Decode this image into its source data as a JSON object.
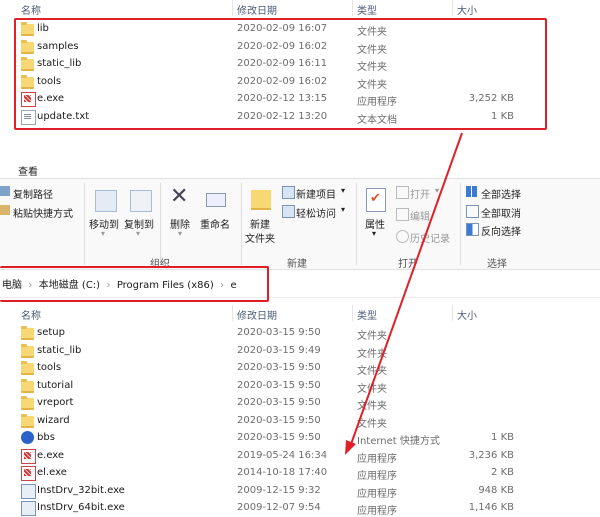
{
  "top_header": {
    "col_name": "名称",
    "col_date": "修改日期",
    "col_type": "类型",
    "col_size": "大小"
  },
  "top_files": [
    {
      "icon": "folder",
      "name": "lib",
      "date": "2020-02-09 16:07",
      "type": "文件夹",
      "size": ""
    },
    {
      "icon": "folder",
      "name": "samples",
      "date": "2020-02-09 16:02",
      "type": "文件夹",
      "size": ""
    },
    {
      "icon": "folder",
      "name": "static_lib",
      "date": "2020-02-09 16:11",
      "type": "文件夹",
      "size": ""
    },
    {
      "icon": "folder",
      "name": "tools",
      "date": "2020-02-09 16:02",
      "type": "文件夹",
      "size": ""
    },
    {
      "icon": "exe",
      "name": "e.exe",
      "date": "2020-02-12 13:15",
      "type": "应用程序",
      "size": "3,252 KB"
    },
    {
      "icon": "text-file",
      "name": "update.txt",
      "date": "2020-02-12 13:20",
      "type": "文本文档",
      "size": "1 KB"
    }
  ],
  "ribbon": {
    "tab_view": "查看",
    "copy_path": "复制路径",
    "paste_shortcut": "粘贴快捷方式",
    "move_to": "移动到",
    "copy_to": "复制到",
    "delete": "删除",
    "rename": "重命名",
    "new_folder_line1": "新建",
    "new_folder_line2": "文件夹",
    "new_item": "新建项目",
    "easy_access": "轻松访问",
    "properties": "属性",
    "open": "打开",
    "edit": "编辑",
    "history": "历史记录",
    "select_all": "全部选择",
    "select_none": "全部取消",
    "invert_selection": "反向选择",
    "group_organize": "组织",
    "group_new": "新建",
    "group_open": "打开",
    "group_select": "选择"
  },
  "breadcrumb": {
    "pc": "电脑",
    "drive": "本地磁盘 (C:)",
    "program_files": "Program Files (x86)",
    "folder": "e"
  },
  "bottom_header": {
    "col_name": "名称",
    "col_date": "修改日期",
    "col_type": "类型",
    "col_size": "大小"
  },
  "bottom_files": [
    {
      "icon": "folder",
      "name": "setup",
      "date": "2020-03-15 9:50",
      "type": "文件夹",
      "size": ""
    },
    {
      "icon": "folder",
      "name": "static_lib",
      "date": "2020-03-15 9:49",
      "type": "文件夹",
      "size": ""
    },
    {
      "icon": "folder",
      "name": "tools",
      "date": "2020-03-15 9:50",
      "type": "文件夹",
      "size": ""
    },
    {
      "icon": "folder",
      "name": "tutorial",
      "date": "2020-03-15 9:50",
      "type": "文件夹",
      "size": ""
    },
    {
      "icon": "folder",
      "name": "vreport",
      "date": "2020-03-15 9:50",
      "type": "文件夹",
      "size": ""
    },
    {
      "icon": "folder",
      "name": "wizard",
      "date": "2020-03-15 9:50",
      "type": "文件夹",
      "size": ""
    },
    {
      "icon": "internet-shortcut",
      "name": "bbs",
      "date": "2020-03-15 9:50",
      "type": "Internet 快捷方式",
      "size": "1 KB"
    },
    {
      "icon": "exe",
      "name": "e.exe",
      "date": "2019-05-24 16:34",
      "type": "应用程序",
      "size": "3,236 KB"
    },
    {
      "icon": "exe",
      "name": "el.exe",
      "date": "2014-10-18 17:40",
      "type": "应用程序",
      "size": "2 KB"
    },
    {
      "icon": "installer",
      "name": "InstDrv_32bit.exe",
      "date": "2009-12-15 9:32",
      "type": "应用程序",
      "size": "948 KB"
    },
    {
      "icon": "installer",
      "name": "InstDrv_64bit.exe",
      "date": "2009-12-07 9:54",
      "type": "应用程序",
      "size": "1,146 KB"
    }
  ],
  "colors": {
    "highlight_red": "#e02028",
    "header_text": "#4b5a76",
    "folder_yellow": "#f8d775"
  }
}
